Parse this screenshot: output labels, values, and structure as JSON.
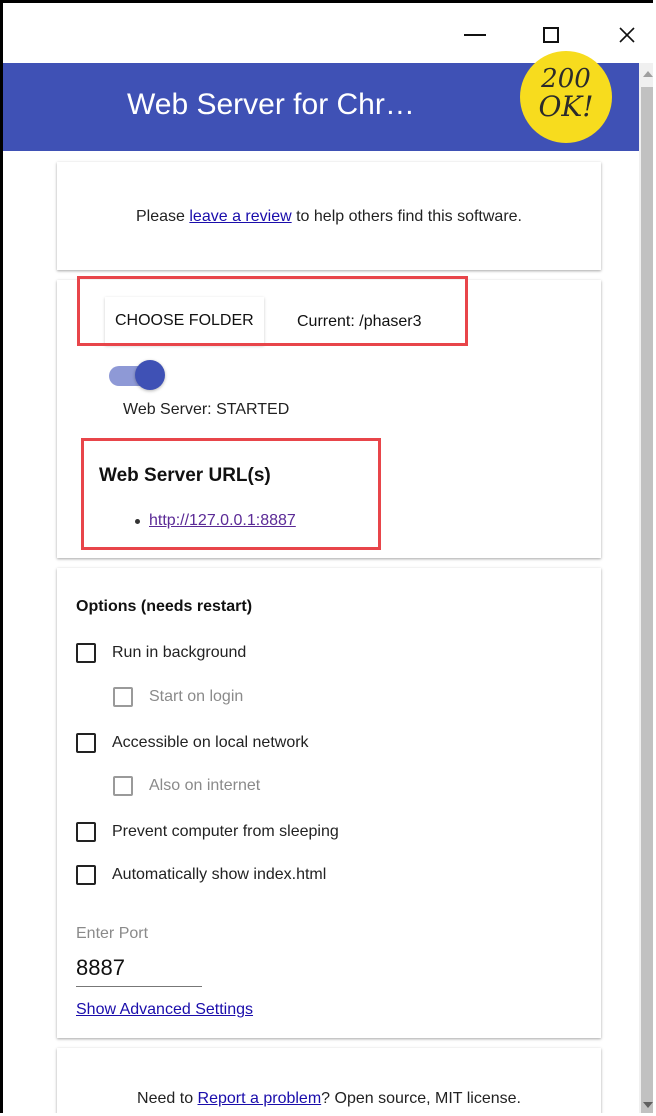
{
  "app": {
    "title": "Web Server for Chr…",
    "logo_line1": "200",
    "logo_line2": "OK!"
  },
  "window_controls": {
    "minimize": "—",
    "maximize": "□",
    "close": "✕"
  },
  "review_card": {
    "prefix": "Please ",
    "link": "leave a review",
    "suffix": " to help others find this software."
  },
  "server_card": {
    "choose_folder_label": "CHOOSE FOLDER",
    "current_folder": "Current: /phaser3",
    "toggle_on": true,
    "status_text": "Web Server: STARTED",
    "urls_title": "Web Server URL(s)",
    "urls": [
      "http://127.0.0.1:8887"
    ]
  },
  "options_card": {
    "title": "Options (needs restart)",
    "options": [
      {
        "label": "Run in background",
        "checked": false,
        "enabled": true
      },
      {
        "label": "Start on login",
        "checked": false,
        "enabled": false
      },
      {
        "label": "Accessible on local network",
        "checked": false,
        "enabled": true
      },
      {
        "label": "Also on internet",
        "checked": false,
        "enabled": false
      },
      {
        "label": "Prevent computer from sleeping",
        "checked": false,
        "enabled": true
      },
      {
        "label": "Automatically show index.html",
        "checked": false,
        "enabled": true
      }
    ],
    "port_label": "Enter Port",
    "port_value": "8887",
    "advanced_link": "Show Advanced Settings"
  },
  "footer_card": {
    "prefix": "Need to ",
    "link": "Report a problem",
    "suffix": "? Open source, MIT license."
  },
  "colors": {
    "appbar": "#3f51b5",
    "toggle_track": "#8e99d6",
    "logo": "#f7dc1e",
    "highlight_box": "#e8454a"
  }
}
